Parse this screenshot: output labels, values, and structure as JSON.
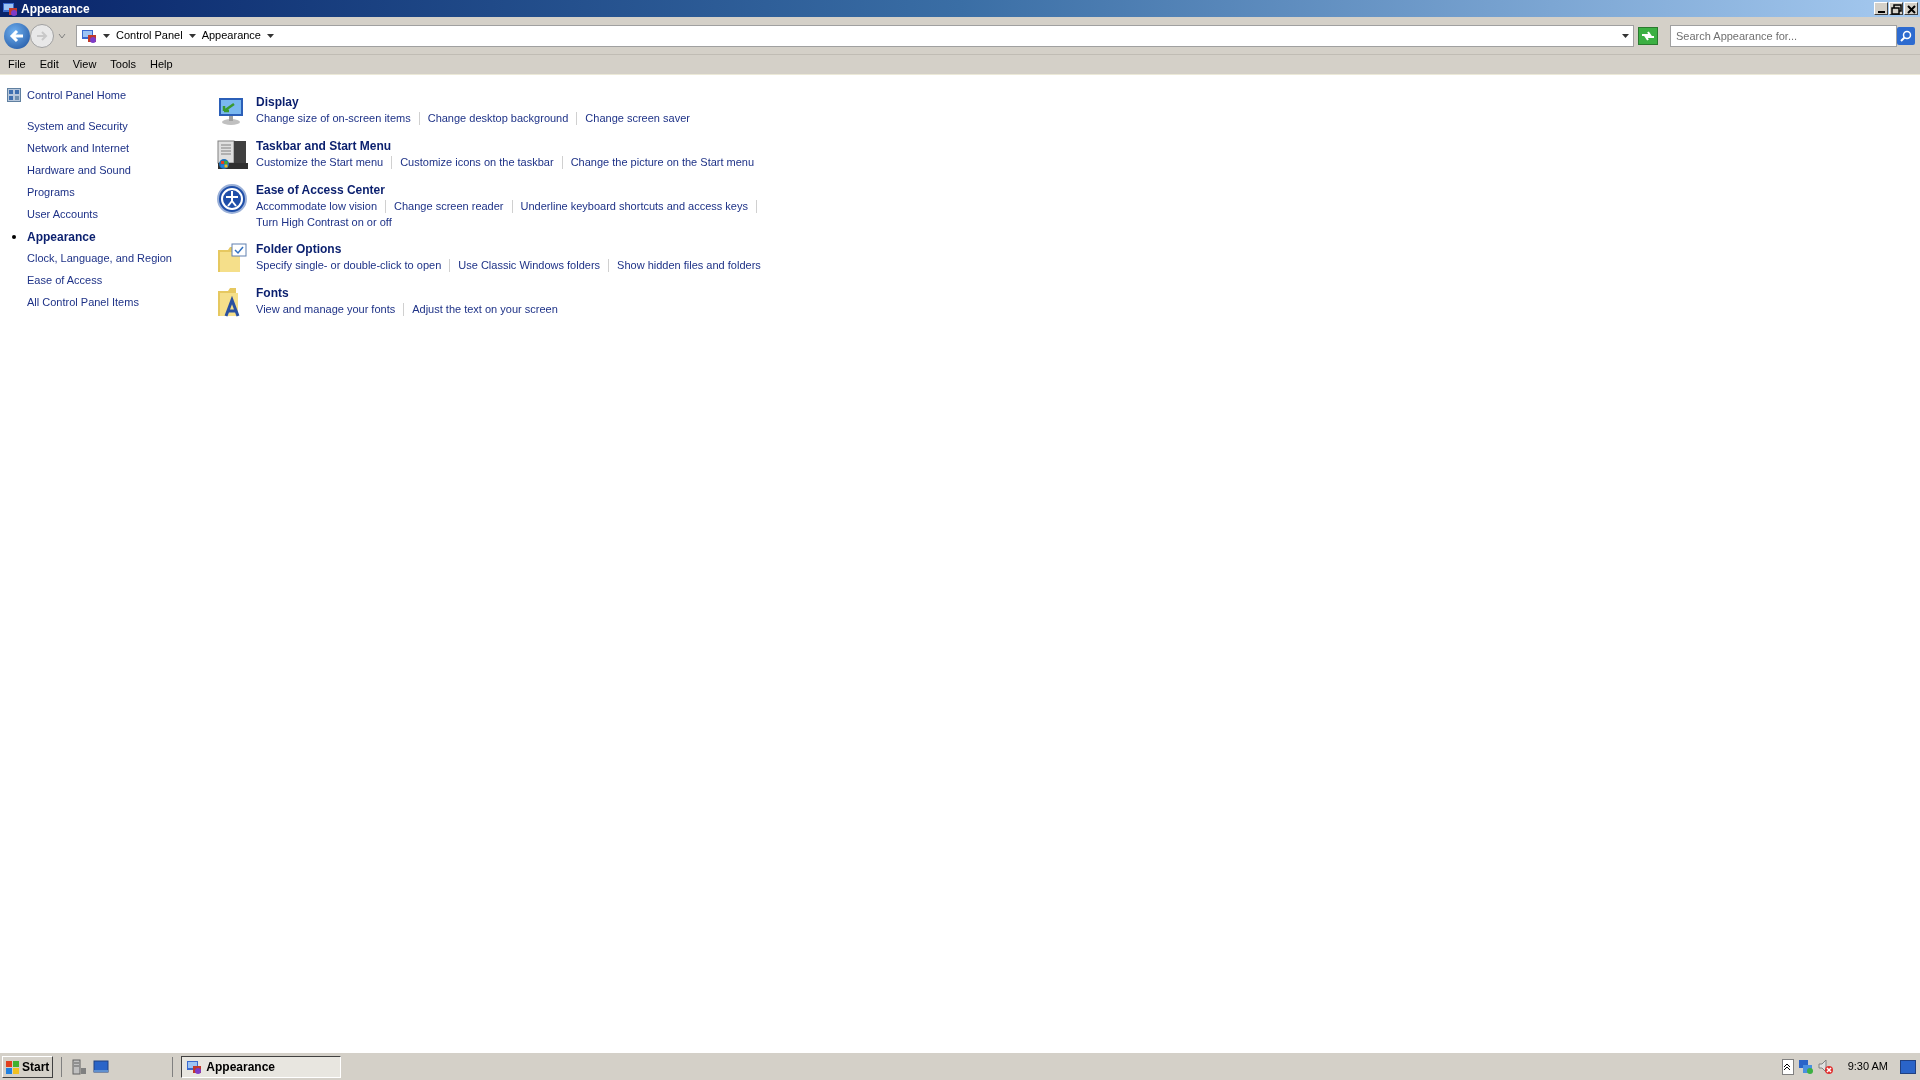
{
  "window": {
    "title": "Appearance"
  },
  "address_bar": {
    "breadcrumb": [
      "Control Panel",
      "Appearance"
    ],
    "search": {
      "placeholder": "Search Appearance for..."
    }
  },
  "menu_bar": [
    "File",
    "Edit",
    "View",
    "Tools",
    "Help"
  ],
  "sidebar": {
    "home": "Control Panel Home",
    "items": [
      {
        "label": "System and Security",
        "selected": false
      },
      {
        "label": "Network and Internet",
        "selected": false
      },
      {
        "label": "Hardware and Sound",
        "selected": false
      },
      {
        "label": "Programs",
        "selected": false
      },
      {
        "label": "User Accounts",
        "selected": false
      },
      {
        "label": "Appearance",
        "selected": true
      },
      {
        "label": "Clock, Language, and Region",
        "selected": false
      },
      {
        "label": "Ease of Access",
        "selected": false
      },
      {
        "label": "All Control Panel Items",
        "selected": false
      }
    ]
  },
  "categories": [
    {
      "kind": "display",
      "title": "Display",
      "link_rows": [
        [
          "Change size of on-screen items",
          "Change desktop background",
          "Change screen saver"
        ]
      ]
    },
    {
      "kind": "taskbar",
      "title": "Taskbar and Start Menu",
      "link_rows": [
        [
          "Customize the Start menu",
          "Customize icons on the taskbar",
          "Change the picture on the Start menu"
        ]
      ]
    },
    {
      "kind": "access",
      "title": "Ease of Access Center",
      "link_rows": [
        [
          "Accommodate low vision",
          "Change screen reader",
          "Underline keyboard shortcuts and access keys"
        ],
        [
          "Turn High Contrast on or off"
        ]
      ]
    },
    {
      "kind": "folder",
      "title": "Folder Options",
      "link_rows": [
        [
          "Specify single- or double-click to open",
          "Use Classic Windows folders",
          "Show hidden files and folders"
        ]
      ]
    },
    {
      "kind": "fonts",
      "title": "Fonts",
      "link_rows": [
        [
          "View and manage your fonts",
          "Adjust the text on your screen"
        ]
      ]
    }
  ],
  "taskbar": {
    "start": "Start",
    "tasks": [
      {
        "label": "Appearance",
        "selected": true
      }
    ],
    "clock": "9:30 AM"
  }
}
